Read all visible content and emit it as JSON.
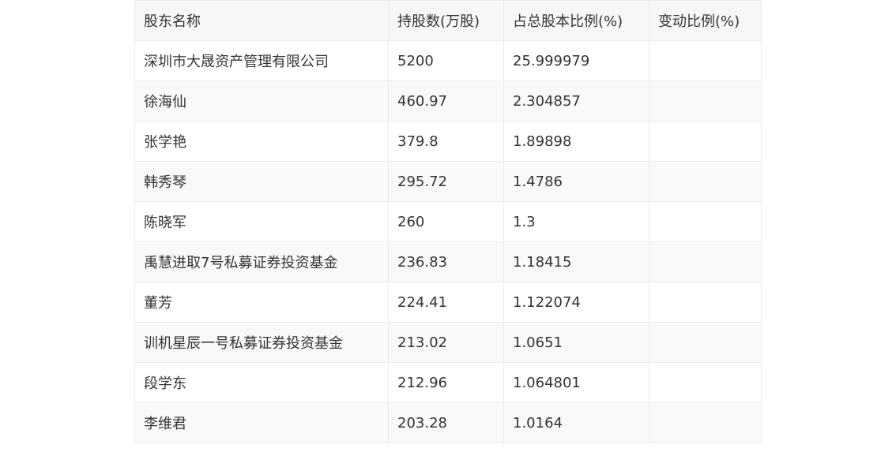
{
  "table": {
    "headers": [
      "股东名称",
      "持股数(万股)",
      "占总股本比例(%)",
      "变动比例(%)"
    ],
    "rows": [
      [
        "深圳市大晟资产管理有限公司",
        "5200",
        "25.999979",
        ""
      ],
      [
        "徐海仙",
        "460.97",
        "2.304857",
        ""
      ],
      [
        "张学艳",
        "379.8",
        "1.89898",
        ""
      ],
      [
        "韩秀琴",
        "295.72",
        "1.4786",
        ""
      ],
      [
        "陈晓军",
        "260",
        "1.3",
        ""
      ],
      [
        "禹慧进取7号私募证券投资基金",
        "236.83",
        "1.18415",
        ""
      ],
      [
        "董芳",
        "224.41",
        "1.122074",
        ""
      ],
      [
        "训机星辰一号私募证券投资基金",
        "213.02",
        "1.0651",
        ""
      ],
      [
        "段学东",
        "212.96",
        "1.064801",
        ""
      ],
      [
        "李维君",
        "203.28",
        "1.0164",
        ""
      ]
    ]
  }
}
